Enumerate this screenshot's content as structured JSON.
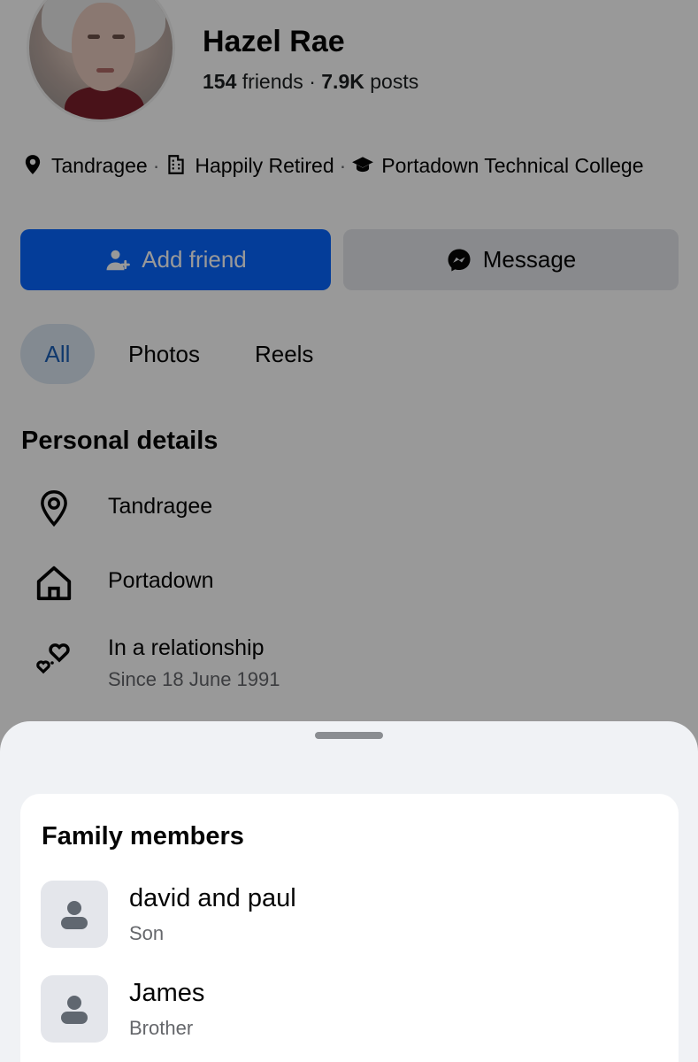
{
  "profile": {
    "name": "Hazel Rae",
    "friends_count": "154",
    "friends_label": "friends",
    "posts_count": "7.9K",
    "posts_label": "posts",
    "separator": "·"
  },
  "intro": {
    "location": "Tandragee",
    "work": "Happily Retired",
    "education": "Portadown Technical College",
    "separator": "·"
  },
  "actions": {
    "add_friend": "Add friend",
    "message": "Message"
  },
  "tabs": [
    {
      "label": "All",
      "active": true
    },
    {
      "label": "Photos",
      "active": false
    },
    {
      "label": "Reels",
      "active": false
    }
  ],
  "personal_details": {
    "title": "Personal details",
    "items": [
      {
        "icon": "location-pin-icon",
        "text": "Tandragee"
      },
      {
        "icon": "home-icon",
        "text": "Portadown"
      },
      {
        "icon": "hearts-icon",
        "text": "In a relationship",
        "subtext": "Since 18 June 1991"
      }
    ]
  },
  "family": {
    "title": "Family members",
    "members": [
      {
        "name": "david and paul",
        "relation": "Son"
      },
      {
        "name": "James",
        "relation": "Brother"
      }
    ]
  },
  "colors": {
    "primary_blue": "#0866ff",
    "tab_active_bg": "#dbe7f2",
    "tab_active_text": "#1b5fb6",
    "sheet_bg": "#f0f2f5",
    "overlay": "rgba(0,0,0,0.40)"
  }
}
